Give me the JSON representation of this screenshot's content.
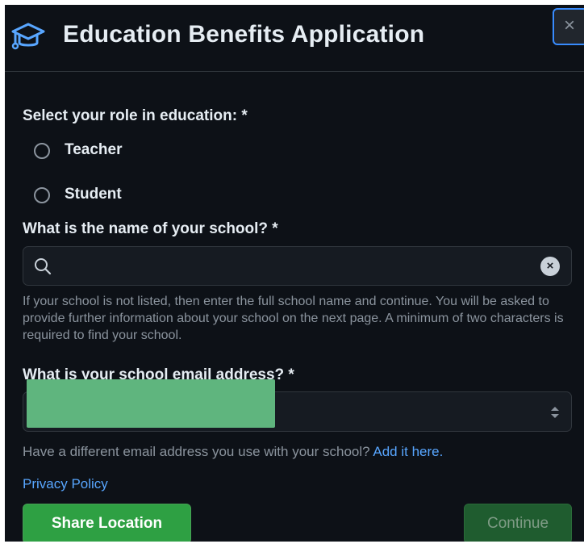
{
  "dialog": {
    "title": "Education Benefits Application",
    "title_icon": "graduation-cap-icon",
    "close_icon": "close-icon",
    "close_label": "×"
  },
  "role": {
    "label": "Select your role in education: *",
    "options": [
      {
        "label": "Teacher",
        "selected": false
      },
      {
        "label": "Student",
        "selected": false
      }
    ]
  },
  "school": {
    "label": "What is the name of your school? *",
    "value": "",
    "placeholder": "",
    "search_icon": "search-icon",
    "clear_icon": "clear-icon",
    "clear_label": "×",
    "helper": "If your school is not listed, then enter the full school name and continue. You will be asked to provide further information about your school on the next page. A minimum of two characters is required to find your school."
  },
  "email": {
    "label": "What is your school email address? *",
    "value_redacted": true,
    "arrows_icon": "select-arrows-icon",
    "alt_text": "Have a different email address you use with your school?",
    "alt_link": "Add it here."
  },
  "footer": {
    "privacy_link": "Privacy Policy",
    "share_button": "Share Location",
    "continue_button": "Continue",
    "continue_disabled": true
  },
  "colors": {
    "background": "#0d1117",
    "accent_blue": "#58a6ff",
    "primary_green": "#2ea043",
    "redaction_green": "#5fb57e"
  }
}
